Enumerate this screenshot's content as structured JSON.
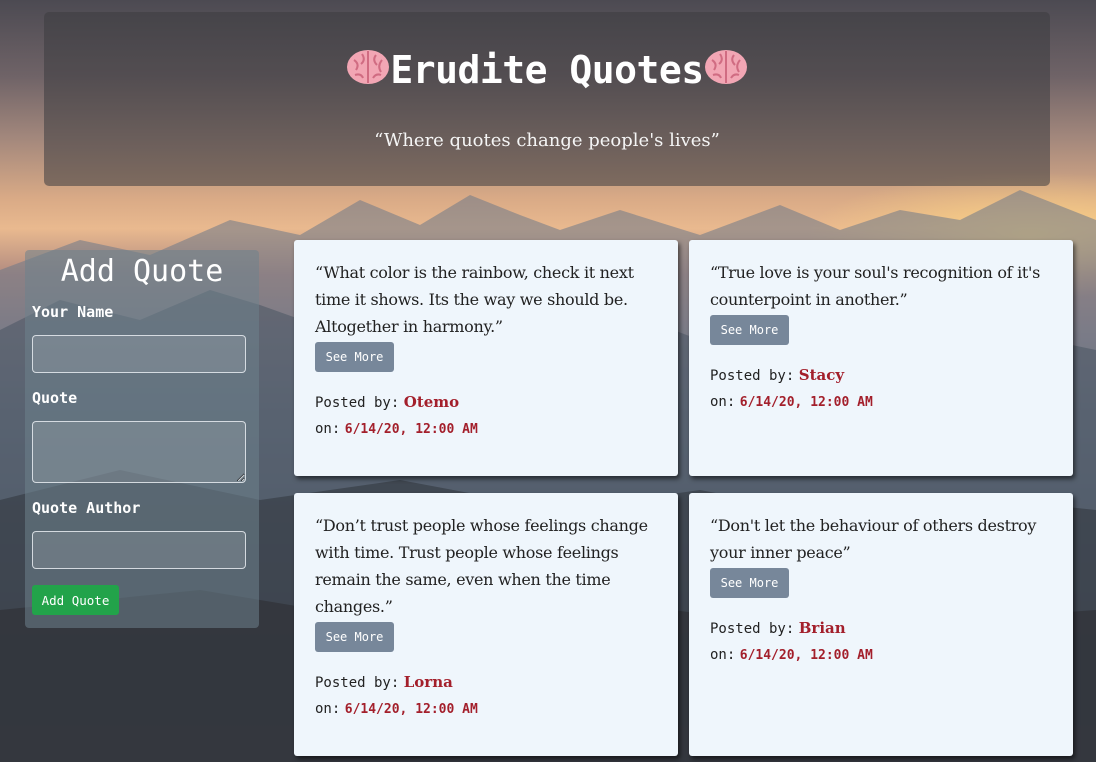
{
  "header": {
    "title": "Erudite Quotes",
    "tagline": "“Where quotes change people's lives”"
  },
  "form": {
    "title": "Add Quote",
    "name_label": "Your Name",
    "name_value": "",
    "quote_label": "Quote",
    "quote_value": "",
    "author_label": "Quote Author",
    "author_value": "",
    "submit_label": "Add Quote"
  },
  "labels": {
    "see_more": "See More",
    "posted_by": "Posted by:",
    "on": "on:"
  },
  "quotes": [
    {
      "text": "“What color is the rainbow, check it next time it shows. Its the way we should be. Altogether in harmony.”",
      "author": "Otemo",
      "date": "6/14/20, 12:00 AM"
    },
    {
      "text": "“True love is your soul's recognition of it's counterpoint in another.”",
      "author": "Stacy",
      "date": "6/14/20, 12:00 AM"
    },
    {
      "text": "“Don’t trust people whose feelings change with time. Trust people whose feelings remain the same, even when the time changes.”",
      "author": "Lorna",
      "date": "6/14/20, 12:00 AM"
    },
    {
      "text": "“Don't let the behaviour of others destroy your inner peace”",
      "author": "Brian",
      "date": "6/14/20, 12:00 AM"
    }
  ],
  "colors": {
    "accent_red": "#a31f2b",
    "button_green": "#22a34a",
    "button_gray": "#77879a",
    "card_bg": "#eff6fc"
  },
  "icons": {
    "brain": "brain-icon"
  }
}
